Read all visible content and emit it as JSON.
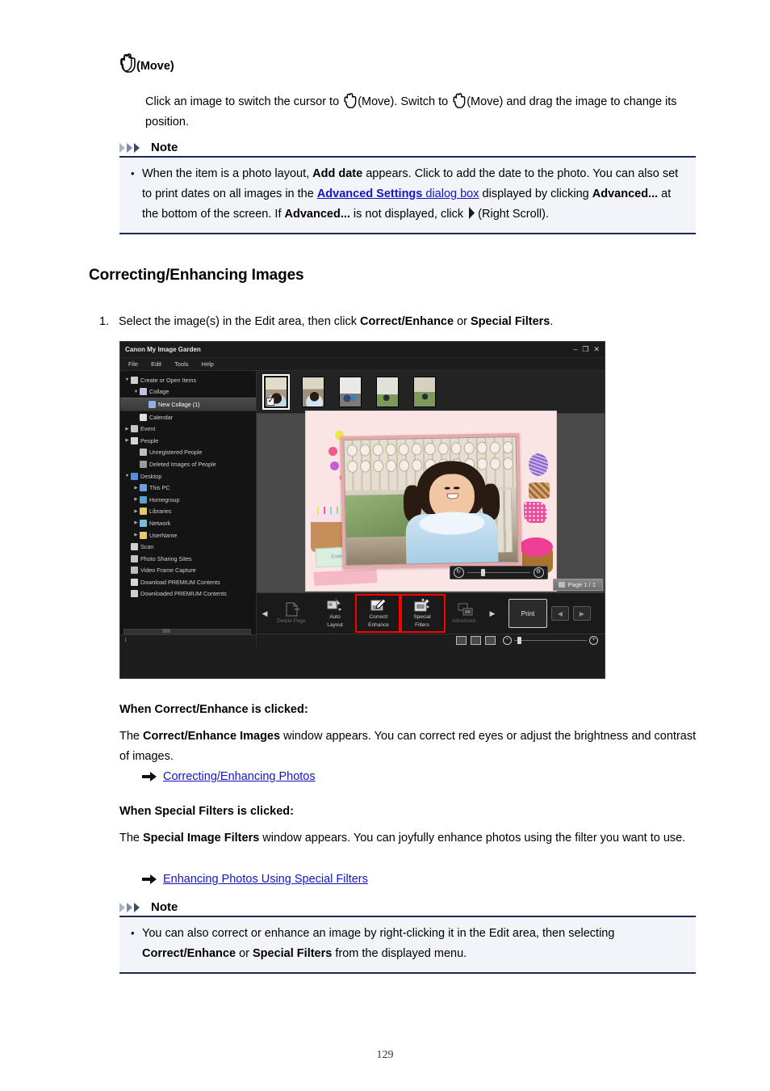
{
  "document": {
    "page_number": "129",
    "move_heading": "(Move)",
    "move_paragraph_a": "Click an image to switch the cursor to ",
    "move_paragraph_b": "(Move). Switch to ",
    "move_paragraph_c": "(Move) and drag the image to change its position.",
    "section_title": "Correcting/Enhancing Images",
    "step_number": "1.",
    "step_text_a": "Select the image(s) in the Edit area, then click ",
    "step_bold_1": "Correct/Enhance",
    "step_text_b": " or ",
    "step_bold_2": "Special Filters",
    "step_text_c": "."
  },
  "note_top": {
    "title": "Note",
    "text_1": "When the item is a photo layout, ",
    "bold_1": "Add date",
    "text_2": " appears. Click to add the date to the photo. You can also set to print dates on all images in the ",
    "link_bold": "Advanced Settings",
    "link_plain": " dialog box",
    "text_3": " displayed by clicking ",
    "bold_2": "Advanced...",
    "text_4": " at the bottom of the screen. If ",
    "bold_3": "Advanced...",
    "text_5": " is not displayed, click ",
    "text_6": "(Right Scroll)."
  },
  "note_bottom": {
    "title": "Note",
    "text_1": "You can also correct or enhance an image by right-clicking it in the Edit area, then selecting ",
    "bold_1": "Correct/Enhance",
    "text_2": " or ",
    "bold_2": "Special Filters",
    "text_3": " from the displayed menu."
  },
  "correct_enhance_section": {
    "heading": "When Correct/Enhance is clicked:",
    "body_a": "The ",
    "body_bold": "Correct/Enhance Images",
    "body_b": " window appears. You can correct red eyes or adjust the brightness and contrast of images.",
    "link": "Correcting/Enhancing Photos"
  },
  "special_filters_section": {
    "heading": "When Special Filters is clicked:",
    "body_a": "The ",
    "body_bold": "Special Image Filters",
    "body_b": " window appears. You can joyfully enhance photos using the filter you want to use.",
    "link": "Enhancing Photos Using Special Filters"
  },
  "app": {
    "title": "Canon My Image Garden",
    "window_buttons": {
      "minimize": "–",
      "maximize": "❐",
      "close": "✕"
    },
    "menu": [
      "File",
      "Edit",
      "Tools",
      "Help"
    ],
    "sidebar": [
      {
        "label": "Create or Open Items",
        "indent": 0,
        "twisty": "▼",
        "icon_color": "#cfcfcf",
        "selected": false
      },
      {
        "label": "Collage",
        "indent": 1,
        "twisty": "▼",
        "icon_color": "#b9c7e0",
        "selected": false
      },
      {
        "label": "New Collage (1)",
        "indent": 2,
        "twisty": "",
        "icon_color": "#8fb3dd",
        "selected": true
      },
      {
        "label": "Calendar",
        "indent": 1,
        "twisty": "",
        "icon_color": "#e0e0e0",
        "selected": false
      },
      {
        "label": "Event",
        "indent": 0,
        "twisty": "▶",
        "icon_color": "#c6c6c6",
        "selected": false
      },
      {
        "label": "People",
        "indent": 0,
        "twisty": "▶",
        "icon_color": "#d5d5d5",
        "selected": false
      },
      {
        "label": "Unregistered People",
        "indent": 1,
        "twisty": "",
        "icon_color": "#bfbfbf",
        "selected": false
      },
      {
        "label": "Deleted Images of People",
        "indent": 1,
        "twisty": "",
        "icon_color": "#9a9a9a",
        "selected": false
      },
      {
        "label": "Desktop",
        "indent": 0,
        "twisty": "▼",
        "icon_color": "#5b8dd6",
        "selected": false
      },
      {
        "label": "This PC",
        "indent": 1,
        "twisty": "▶",
        "icon_color": "#6aa0e0",
        "selected": false
      },
      {
        "label": "Homegroup",
        "indent": 1,
        "twisty": "▶",
        "icon_color": "#55a3d6",
        "selected": false
      },
      {
        "label": "Libraries",
        "indent": 1,
        "twisty": "▶",
        "icon_color": "#e8c86a",
        "selected": false
      },
      {
        "label": "Network",
        "indent": 1,
        "twisty": "▶",
        "icon_color": "#6fbfe0",
        "selected": false
      },
      {
        "label": "UserName",
        "indent": 1,
        "twisty": "▶",
        "icon_color": "#e8c86a",
        "selected": false
      },
      {
        "label": "Scan",
        "indent": 0,
        "twisty": "",
        "icon_color": "#d0d0d0",
        "selected": false
      },
      {
        "label": "Photo Sharing Sites",
        "indent": 0,
        "twisty": "",
        "icon_color": "#c3c3c3",
        "selected": false
      },
      {
        "label": "Video Frame Capture",
        "indent": 0,
        "twisty": "",
        "icon_color": "#bcbcbc",
        "selected": false
      },
      {
        "label": "Download PREMIUM Contents",
        "indent": 0,
        "twisty": "",
        "icon_color": "#d6d6d6",
        "selected": false
      },
      {
        "label": "Downloaded PREMIUM Contents",
        "indent": 0,
        "twisty": "",
        "icon_color": "#cfcfcf",
        "selected": false
      }
    ],
    "status_icon": "i",
    "thumbnails": [
      {
        "selected": true,
        "checked": true
      },
      {
        "selected": false,
        "checked": false
      },
      {
        "selected": false,
        "checked": false
      },
      {
        "selected": false,
        "checked": false
      },
      {
        "selected": false,
        "checked": false
      }
    ],
    "canvas": {
      "text_placeholder": "Enter text",
      "page_tab_label": "Page 1 / 1"
    },
    "toolbar": {
      "left_scroll": "◀",
      "right_scroll": "▶",
      "buttons": [
        {
          "name": "delete-page",
          "line1": "Delete Page",
          "line2": "",
          "disabled": true,
          "highlight": false
        },
        {
          "name": "auto-layout",
          "line1": "Auto",
          "line2": "Layout",
          "disabled": false,
          "highlight": false
        },
        {
          "name": "correct-enhance",
          "line1": "Correct/",
          "line2": "Enhance",
          "disabled": false,
          "highlight": true
        },
        {
          "name": "special-filters",
          "line1": "Special",
          "line2": "Filters",
          "disabled": false,
          "highlight": true
        },
        {
          "name": "advanced",
          "line1": "Advanced...",
          "line2": "",
          "disabled": true,
          "highlight": false
        }
      ],
      "print_label": "Print",
      "nav_prev": "◀",
      "nav_next": "▶"
    },
    "statusbar": {
      "zoom_out": "−",
      "zoom_in": "+"
    },
    "highlight_color": "#ff0000"
  }
}
